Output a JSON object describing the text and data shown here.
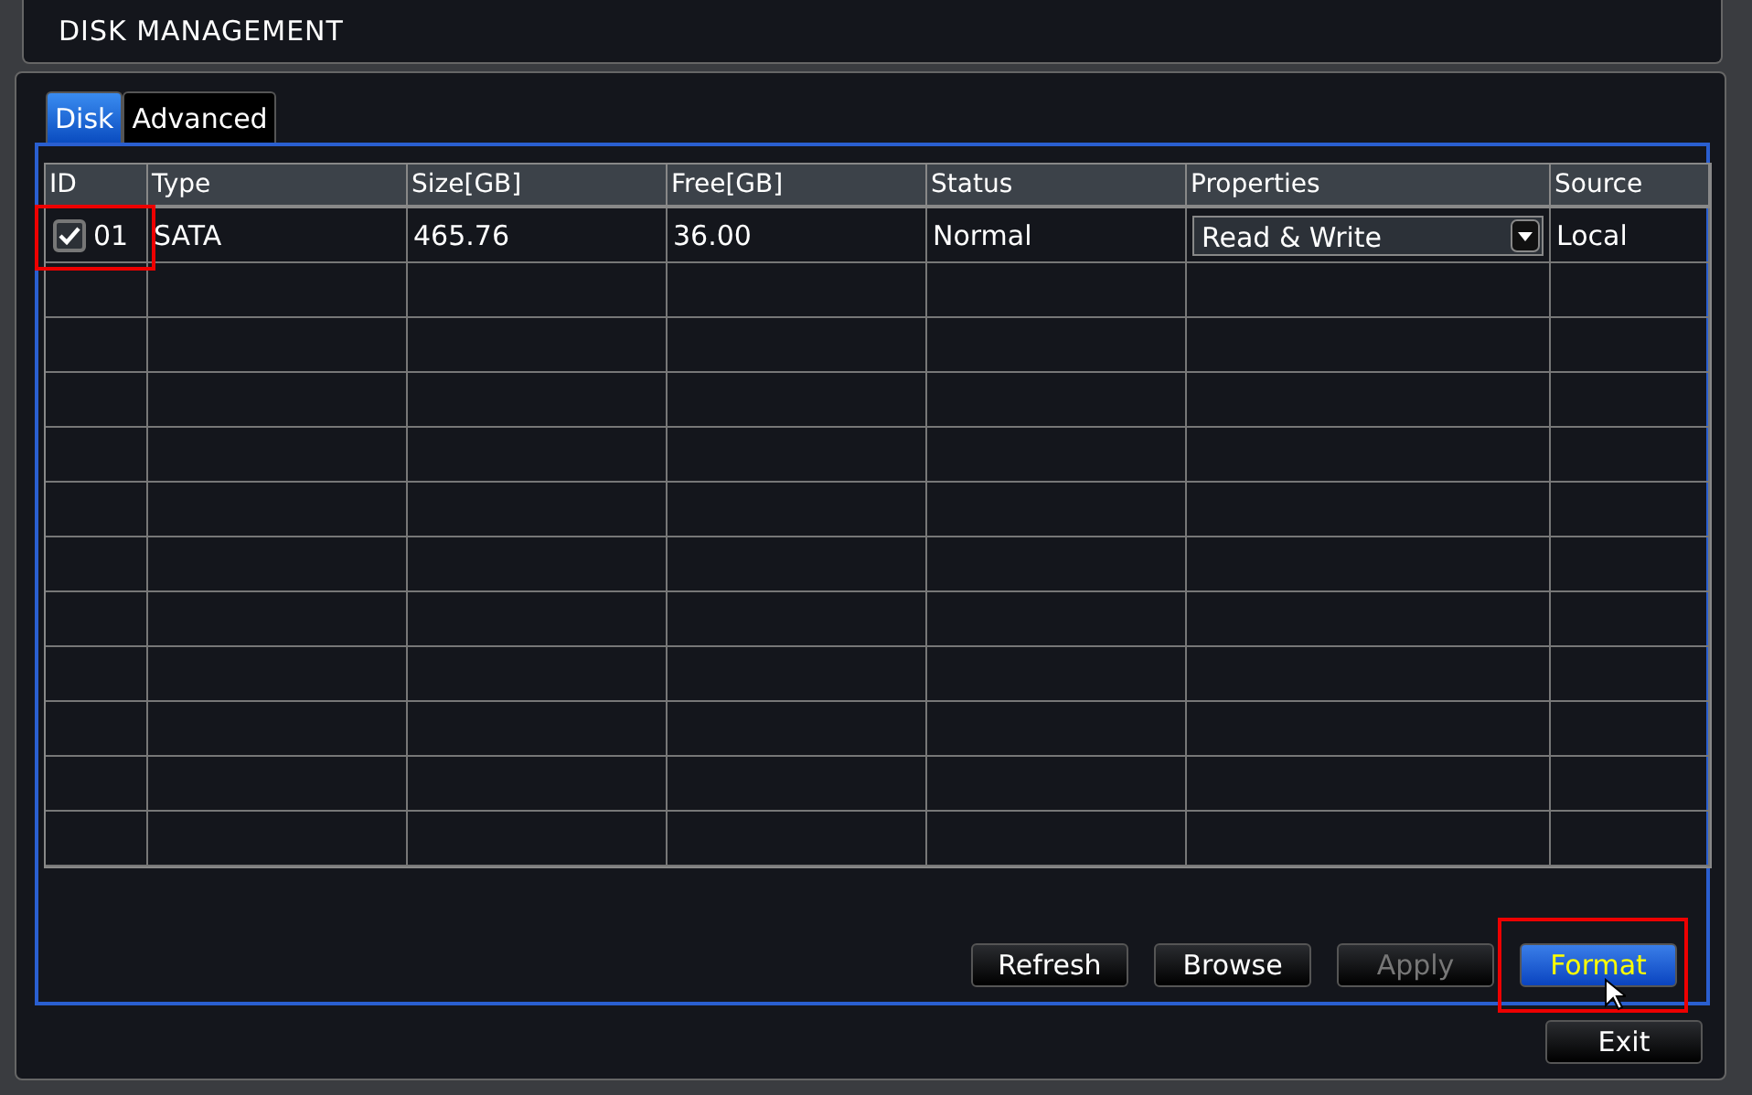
{
  "window": {
    "title": "DISK MANAGEMENT"
  },
  "tabs": [
    {
      "label": "Disk",
      "selected": true
    },
    {
      "label": "Advanced",
      "selected": false
    }
  ],
  "table": {
    "columns": [
      "ID",
      "Type",
      "Size[GB]",
      "Free[GB]",
      "Status",
      "Properties",
      "Source"
    ],
    "rows": [
      {
        "checked": true,
        "highlighted": true,
        "id": "01",
        "type": "SATA",
        "size": "465.76",
        "free": "36.00",
        "status": "Normal",
        "properties": "Read & Write",
        "source": "Local"
      }
    ]
  },
  "buttons": [
    {
      "label": "Refresh",
      "disabled": false,
      "focused": false,
      "highlighted": false
    },
    {
      "label": "Browse",
      "disabled": false,
      "focused": false,
      "highlighted": false
    },
    {
      "label": "Apply",
      "disabled": true,
      "focused": false,
      "highlighted": false
    },
    {
      "label": "Format",
      "disabled": false,
      "focused": true,
      "highlighted": true
    }
  ],
  "exit_button": {
    "label": "Exit"
  }
}
